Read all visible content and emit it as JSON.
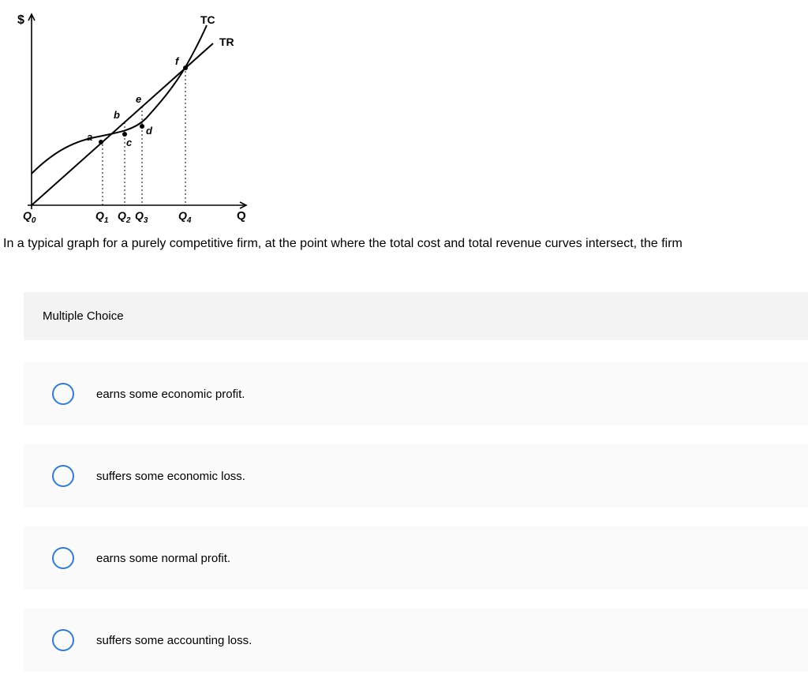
{
  "graph": {
    "y_label": "$",
    "x_label": "Q",
    "curve_tc": "TC",
    "curve_tr": "TR",
    "points": {
      "a": "a",
      "b": "b",
      "c": "c",
      "d": "d",
      "e": "e",
      "f": "f"
    },
    "x_ticks": {
      "q0": "Q",
      "q0_sub": "0",
      "q1": "Q",
      "q1_sub": "1",
      "q2": "Q",
      "q2_sub": "2",
      "q3": "Q",
      "q3_sub": "3",
      "q4": "Q",
      "q4_sub": "4"
    }
  },
  "question": "In a typical graph for a purely competitive firm, at the point where the total cost and total revenue curves intersect, the firm",
  "mc_header": "Multiple Choice",
  "choices": [
    "earns some economic profit.",
    "suffers some economic loss.",
    "earns some normal profit.",
    "suffers some accounting loss."
  ]
}
